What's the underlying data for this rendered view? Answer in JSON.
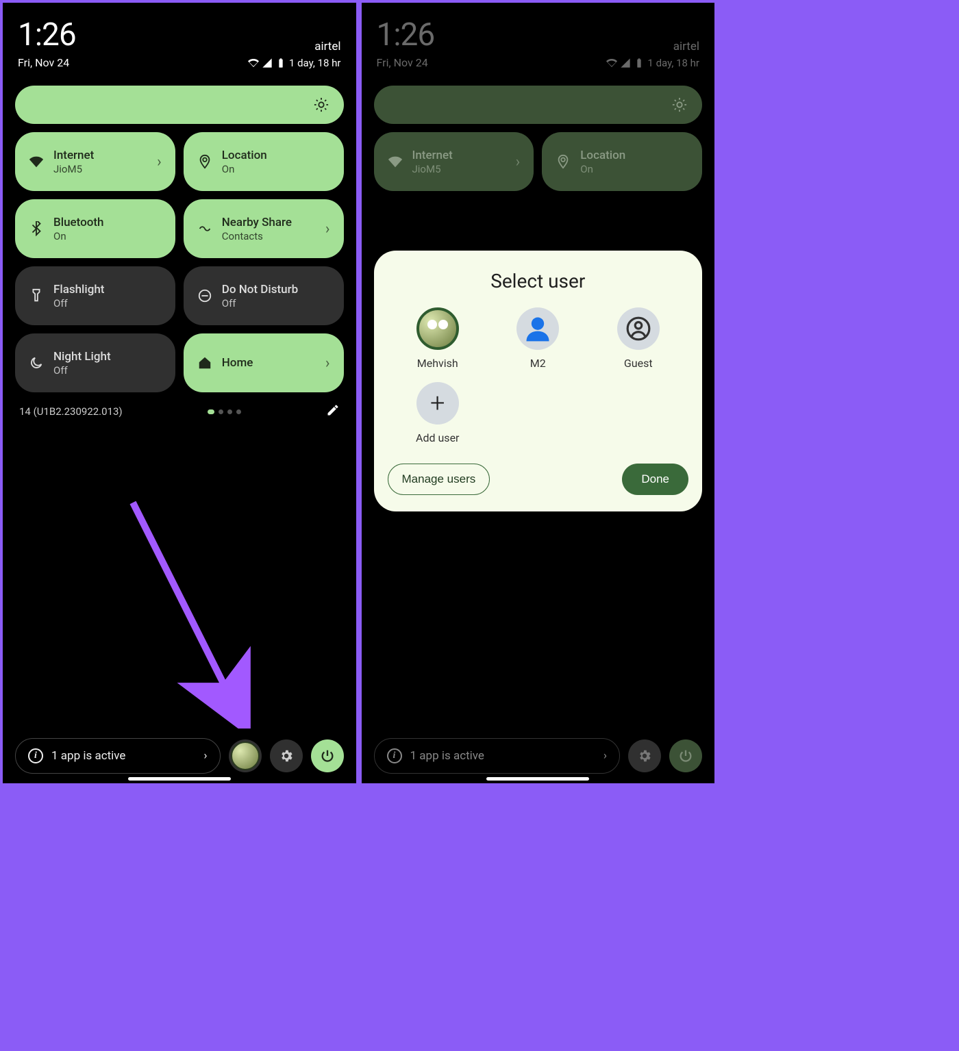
{
  "status": {
    "time": "1:26",
    "carrier": "airtel",
    "date": "Fri, Nov 24",
    "battery_text": "1 day, 18 hr"
  },
  "tiles": {
    "internet": {
      "title": "Internet",
      "value": "JioM5"
    },
    "location": {
      "title": "Location",
      "value": "On"
    },
    "bluetooth": {
      "title": "Bluetooth",
      "value": "On"
    },
    "nearby": {
      "title": "Nearby Share",
      "value": "Contacts"
    },
    "flashlight": {
      "title": "Flashlight",
      "value": "Off"
    },
    "dnd": {
      "title": "Do Not Disturb",
      "value": "Off"
    },
    "night": {
      "title": "Night Light",
      "value": "Off"
    },
    "home": {
      "title": "Home",
      "value": ""
    }
  },
  "build": "14 (U1B2.230922.013)",
  "bottom": {
    "active_label": "1 app is active"
  },
  "dialog": {
    "title": "Select user",
    "users": {
      "u1": "Mehvish",
      "u2": "M2",
      "u3": "Guest",
      "add": "Add user"
    },
    "manage": "Manage users",
    "done": "Done"
  }
}
